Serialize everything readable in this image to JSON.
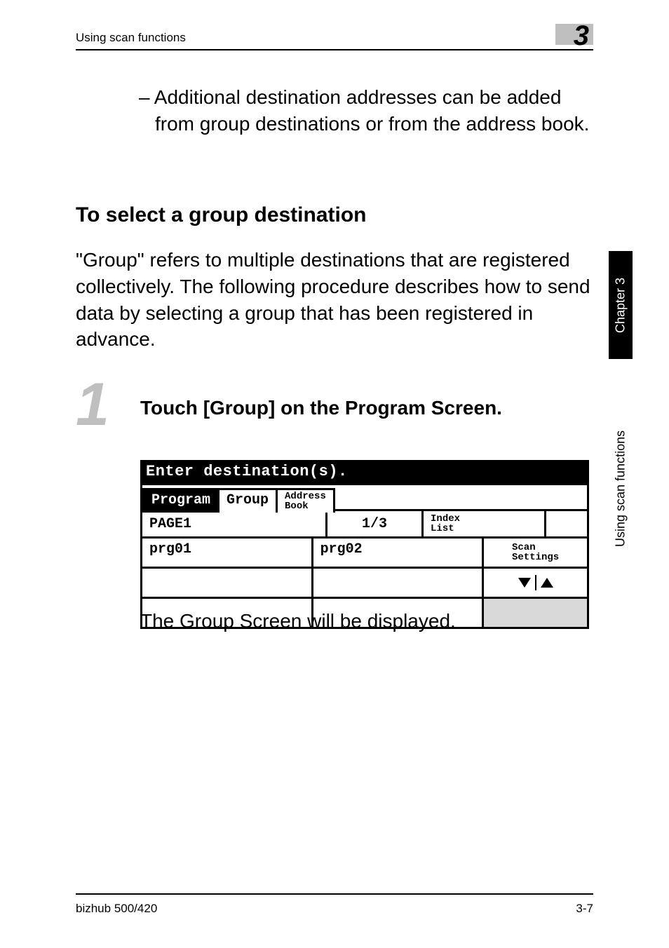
{
  "header": {
    "left": "Using scan functions",
    "badge": "3"
  },
  "bullet": "– Additional destination addresses can be added from group destinations or from the address book.",
  "heading": "To select a group destination",
  "paragraph": "\"Group\" refers to multiple destinations that are registered collectively. The following procedure describes how to send data by selecting a group that has been registered in advance.",
  "step": {
    "number": "1",
    "title": "Touch [Group] on the Program Screen."
  },
  "panel": {
    "title": "Enter destination(s).",
    "tabs": {
      "program": "Program",
      "group": "Group",
      "address_l1": "Address",
      "address_l2": "Book"
    },
    "page_label": "PAGE1",
    "page_count": "1/3",
    "index_l1": "Index",
    "index_l2": "List",
    "entries": {
      "e1": "prg01",
      "e2": "prg02"
    },
    "scan_l1": "Scan",
    "scan_l2": "Settings"
  },
  "caption": "The Group Screen will be displayed.",
  "side": {
    "chapter": "Chapter 3",
    "using": "Using scan functions"
  },
  "footer": {
    "left": "bizhub 500/420",
    "right": "3-7"
  }
}
